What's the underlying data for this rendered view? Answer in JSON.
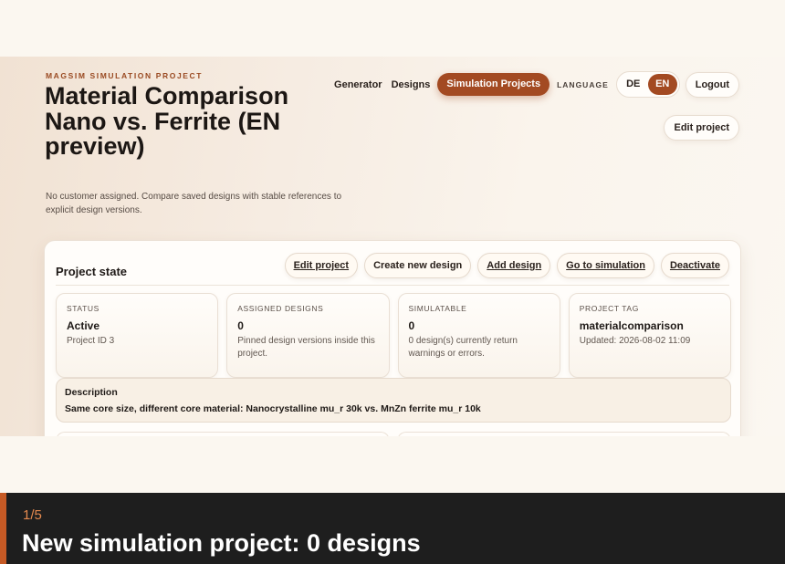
{
  "header": {
    "eyebrow": "MAGSIM SIMULATION PROJECT",
    "title": "Material Comparison Nano vs. Ferrite (EN preview)",
    "subtitle": "No customer assigned. Compare saved designs with stable references to explicit design versions."
  },
  "nav": {
    "generator": "Generator",
    "designs": "Designs",
    "simulation_projects": "Simulation Projects",
    "language_label": "LANGUAGE",
    "lang_de": "DE",
    "lang_en": "EN",
    "active_language": "EN",
    "logout": "Logout",
    "edit_project": "Edit project"
  },
  "card": {
    "title": "Project state",
    "actions": {
      "edit_project": "Edit project",
      "create_new_design": "Create new design",
      "add_design": "Add design",
      "go_to_simulation": "Go to simulation",
      "deactivate": "Deactivate"
    },
    "stats": [
      {
        "label": "STATUS",
        "value": "Active",
        "note": "Project ID 3"
      },
      {
        "label": "ASSIGNED DESIGNS",
        "value": "0",
        "note": "Pinned design versions inside this project."
      },
      {
        "label": "SIMULATABLE",
        "value": "0",
        "note": "0 design(s) currently return warnings or errors."
      },
      {
        "label": "PROJECT TAG",
        "value": "materialcomparison",
        "note": "Updated: 2026-08-02 11:09"
      }
    ],
    "description": {
      "label": "Description",
      "text": "Same core size, different core material: Nanocrystalline mu_r 30k vs. MnZn ferrite mu_r 10k"
    }
  },
  "footer": {
    "step": "1/5",
    "caption": "New simulation project: 0 designs"
  },
  "colors": {
    "accent": "#a34a22",
    "footer_bg": "#1e1e1e",
    "footer_step": "#e58a4f"
  }
}
